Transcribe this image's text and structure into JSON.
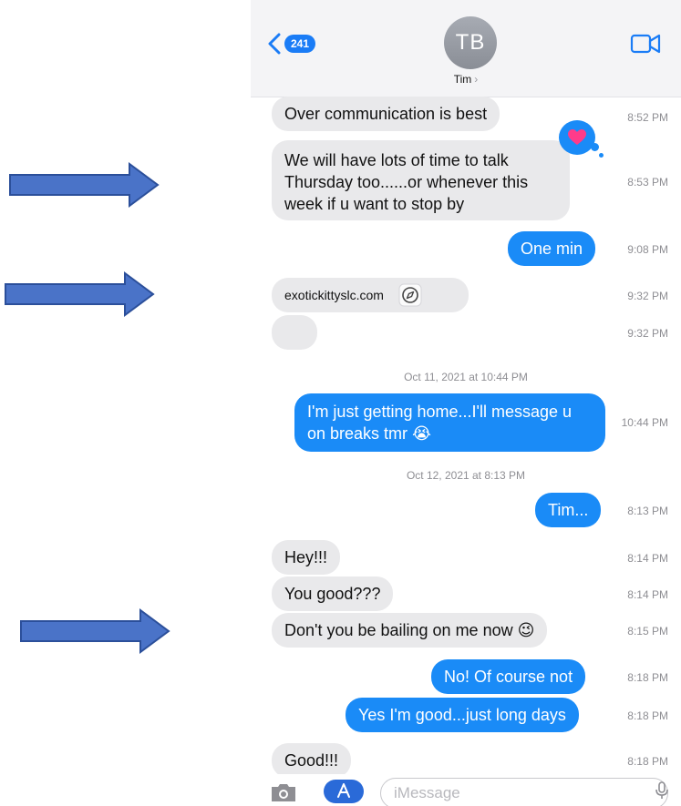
{
  "header": {
    "back_count": "241",
    "avatar_initials": "TB",
    "contact_name": "Tim",
    "contact_chevron": "›"
  },
  "messages": [
    {
      "dir": "in",
      "text": "Over communication is best",
      "time": "8:52 PM"
    },
    {
      "dir": "in",
      "text": "We will have lots of time to talk Thursday too......or whenever this week if u want to stop by",
      "time": "8:53 PM",
      "tapback": "heart-tapback-icon"
    },
    {
      "dir": "out",
      "text": "One min",
      "time": "9:08 PM"
    },
    {
      "dir": "in",
      "link": "exotickittyslc.com",
      "time": "9:32 PM"
    },
    {
      "dir": "in",
      "text": "",
      "time": "9:32 PM"
    },
    {
      "dir": "out",
      "text": "I'm just getting home...I'll message u  on breaks tmr 😭",
      "time": "10:44 PM"
    },
    {
      "dir": "out",
      "text": "Tim...",
      "time": "8:13 PM"
    },
    {
      "dir": "in",
      "text": "Hey!!!",
      "time": "8:14 PM"
    },
    {
      "dir": "in",
      "text": "You good???",
      "time": "8:14 PM"
    },
    {
      "dir": "in",
      "text": "Don't you be bailing on me now 😉",
      "time": "8:15 PM"
    },
    {
      "dir": "out",
      "text": "No! Of course not",
      "time": "8:18 PM"
    },
    {
      "dir": "out",
      "text": "Yes I'm good...just long days",
      "time": "8:18 PM"
    },
    {
      "dir": "in",
      "text": "Good!!!",
      "time": "8:18 PM"
    }
  ],
  "stamps": [
    "Oct 11, 2021 at 10:44 PM",
    "Oct 12, 2021 at 8:13 PM"
  ],
  "input": {
    "placeholder": "iMessage"
  },
  "colors": {
    "accent": "#1a8bf7",
    "incoming": "#e9e9eb",
    "arrow_fill": "#4a73c8",
    "arrow_stroke": "#2b4f9a"
  },
  "annotations": [
    "arrow-annotation",
    "arrow-annotation",
    "arrow-annotation"
  ]
}
